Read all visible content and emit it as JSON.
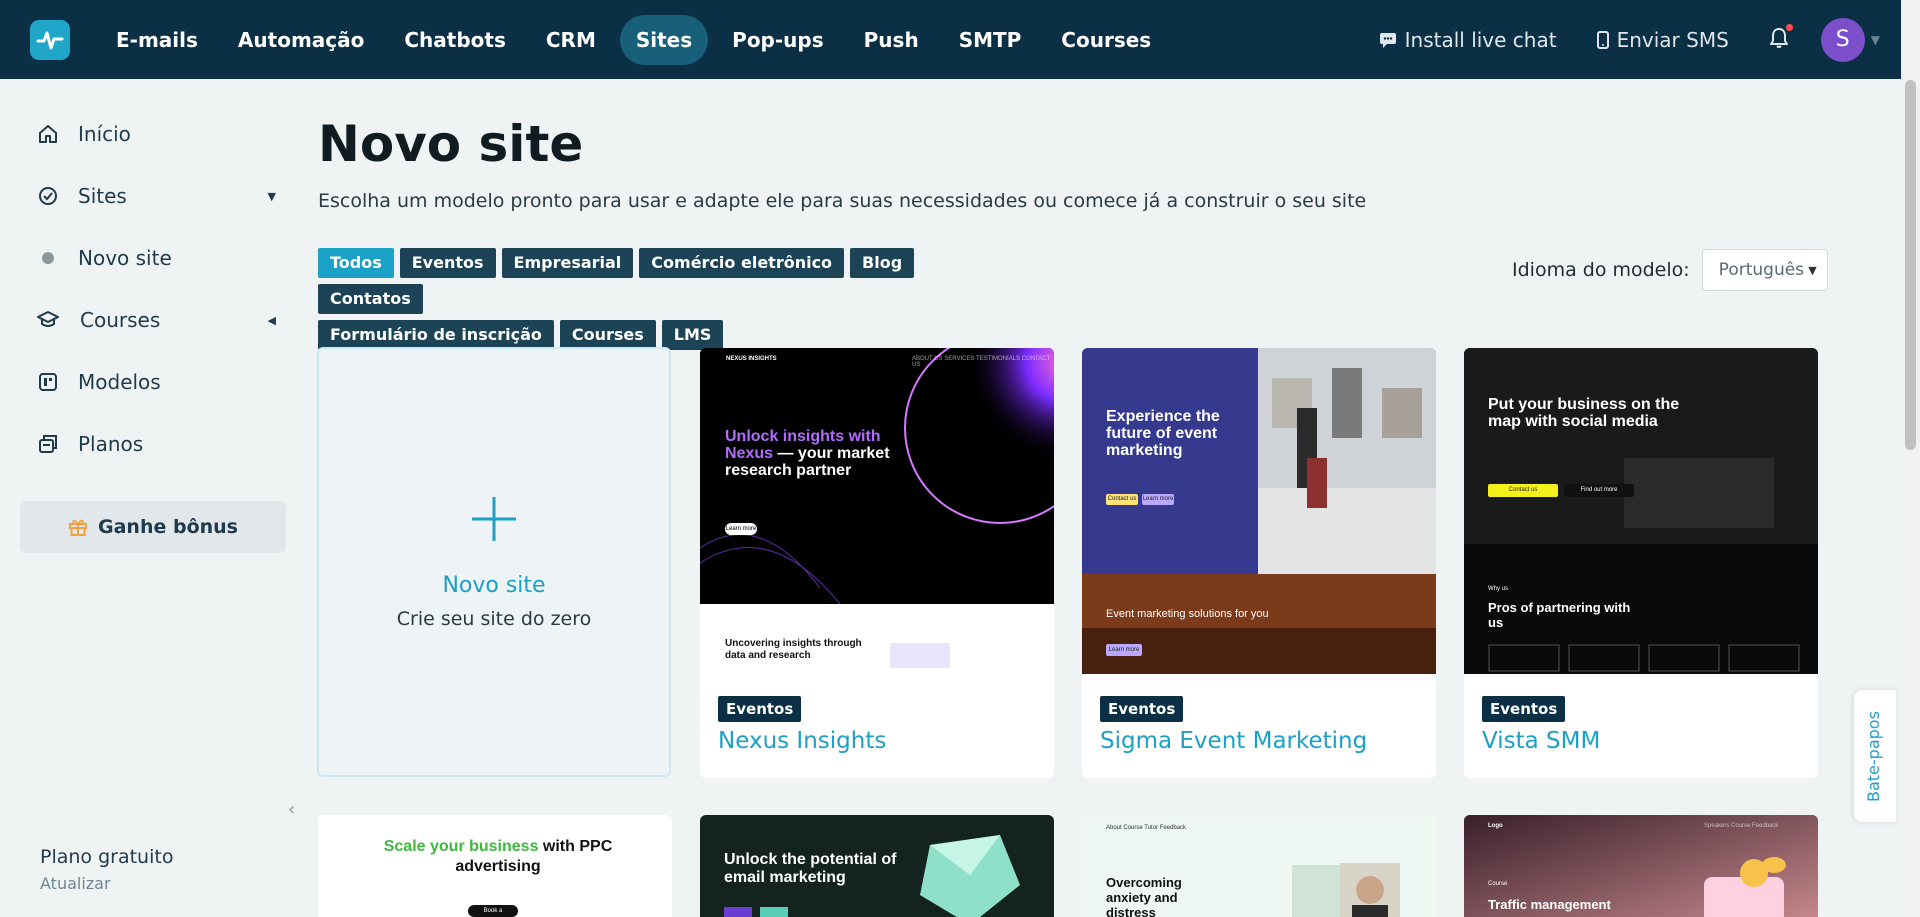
{
  "nav": {
    "items": [
      {
        "label": "E-mails"
      },
      {
        "label": "Automação"
      },
      {
        "label": "Chatbots"
      },
      {
        "label": "CRM"
      },
      {
        "label": "Sites",
        "active": true
      },
      {
        "label": "Pop-ups"
      },
      {
        "label": "Push"
      },
      {
        "label": "SMTP"
      },
      {
        "label": "Courses"
      }
    ],
    "install_live_chat": "Install live chat",
    "send_sms": "Enviar SMS",
    "avatar_letter": "S"
  },
  "sidebar": {
    "items": [
      {
        "label": "Início"
      },
      {
        "label": "Sites"
      },
      {
        "label": "Novo site"
      },
      {
        "label": "Courses"
      },
      {
        "label": "Modelos"
      },
      {
        "label": "Planos"
      }
    ],
    "bonus": "Ganhe bônus",
    "plan_name": "Plano gratuito",
    "plan_upgrade": "Atualizar"
  },
  "main": {
    "title": "Novo site",
    "subtitle": "Escolha um modelo pronto para usar e adapte ele para suas necessidades ou comece já a construir o seu site",
    "filters": [
      "Todos",
      "Eventos",
      "Empresarial",
      "Comércio eletrônico",
      "Blog",
      "Contatos",
      "Formulário de inscrição",
      "Courses",
      "LMS"
    ],
    "language_label": "Idioma do modelo:",
    "language_value": "Português"
  },
  "new_site": {
    "title": "Novo site",
    "subtitle": "Crie seu site do zero"
  },
  "templates": [
    {
      "tag": "Eventos",
      "name": "Nexus Insights",
      "preview": {
        "brand": "NEXUS INSIGHTS",
        "nav": "ABOUT US   SERVICES   TESTIMONIALS   CONTACT US",
        "headline_accent": "Unlock insights with Nexus",
        "headline_rest": " — your market research partner",
        "button": "Learn more",
        "section": "Uncovering insights through data and research"
      }
    },
    {
      "tag": "Eventos",
      "name": "Sigma Event Marketing",
      "preview": {
        "headline": "Experience the future of event marketing",
        "btn1": "Contact us",
        "btn2": "Learn more",
        "section": "Event marketing solutions for you",
        "btn3": "Learn more"
      }
    },
    {
      "tag": "Eventos",
      "name": "Vista SMM",
      "preview": {
        "headline": "Put your business on the map with social media",
        "btn1": "Contact us",
        "btn2": "Find out more",
        "small": "Why us",
        "section": "Pros of partnering with us"
      }
    }
  ],
  "row2": [
    {
      "headline_accent": "Scale your business",
      "headline_rest": " with PPC advertising",
      "button": "Book a consultation"
    },
    {
      "headline": "Unlock the potential of email marketing"
    },
    {
      "nav": "About   Course   Tutor   Feedback",
      "headline": "Overcoming anxiety and distress"
    },
    {
      "brand": "Logo",
      "nav": "Speakers   Course   Feedback",
      "small": "Course",
      "headline": "Traffic management"
    }
  ],
  "chat_tab": "Bate-papos"
}
